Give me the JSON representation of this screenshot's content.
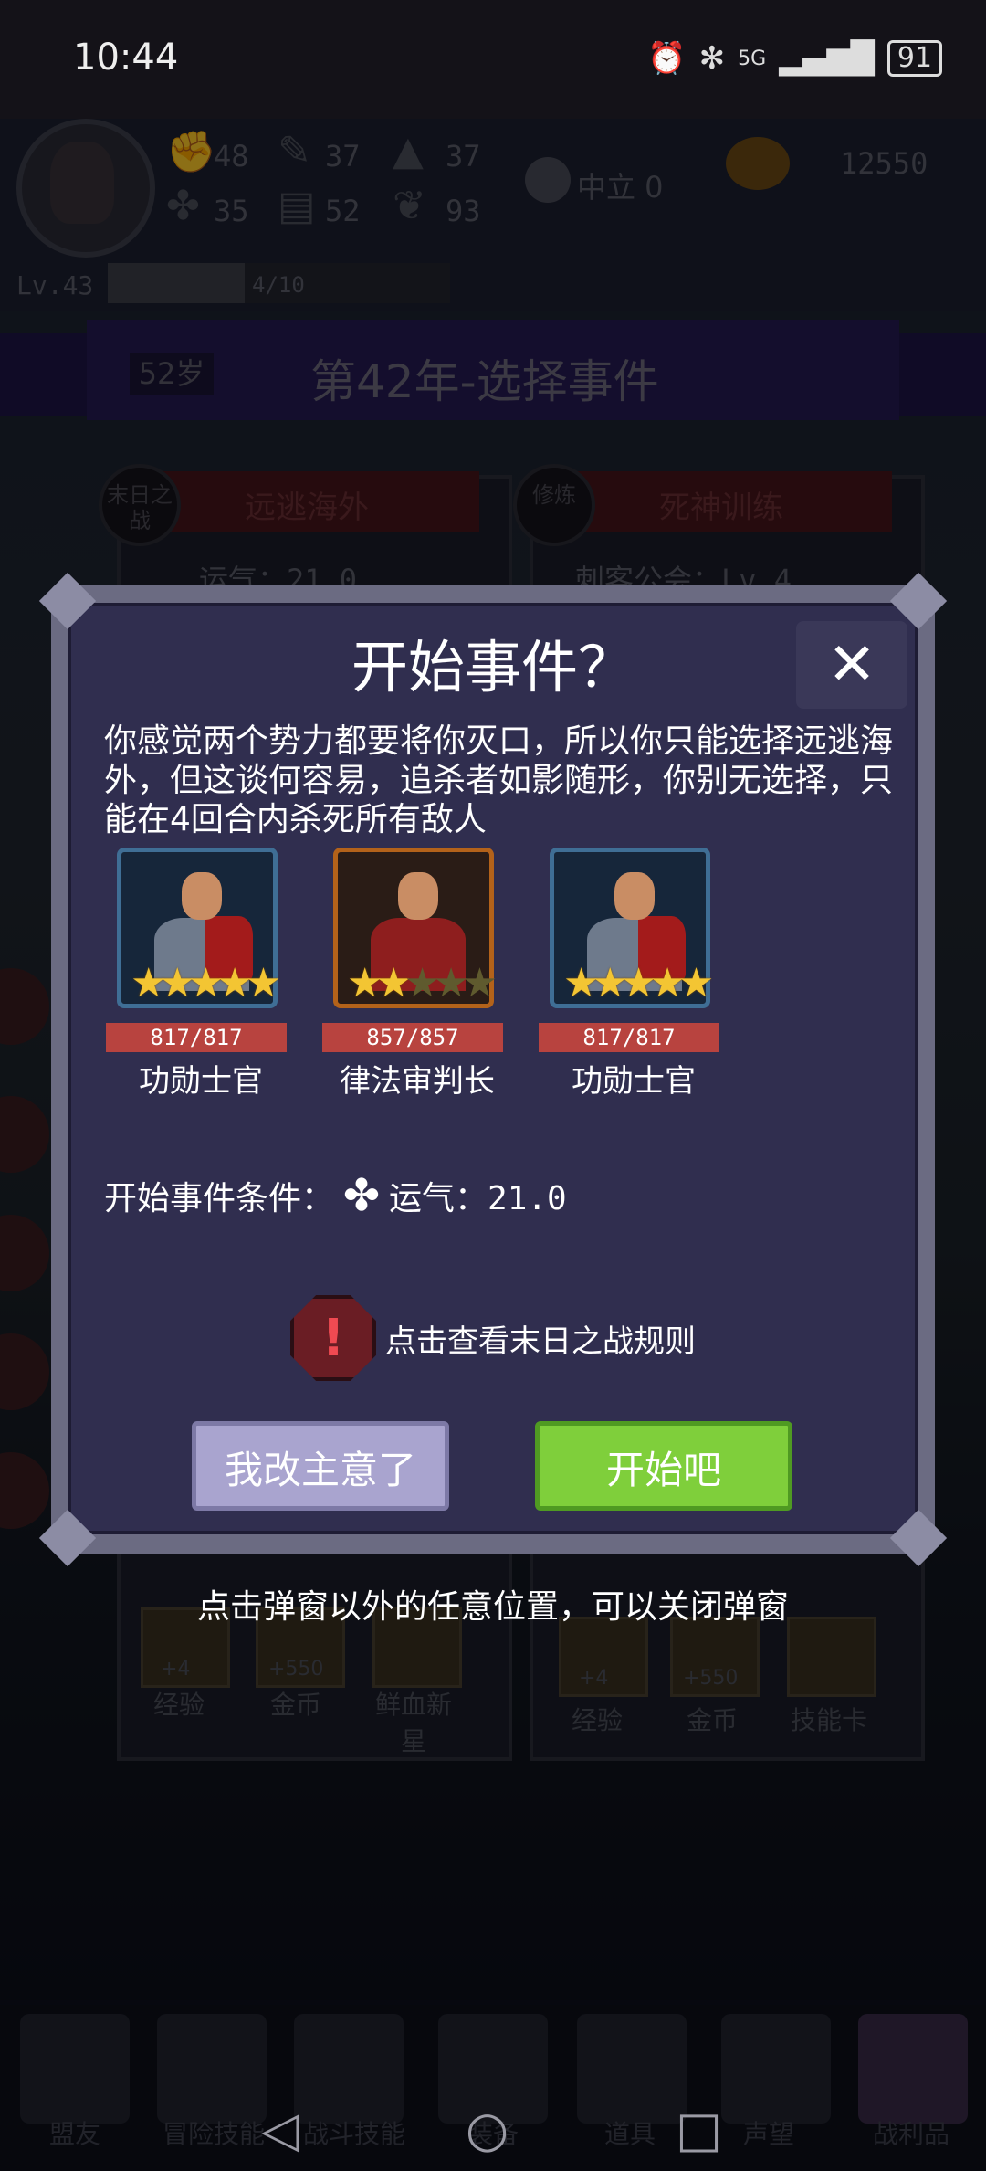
{
  "status_bar": {
    "time": "10:44",
    "signal": "5G",
    "battery": "91"
  },
  "header": {
    "stats": [
      "48",
      "37",
      "37",
      "35",
      "52",
      "93"
    ],
    "alignment": "中立 0",
    "coins": "12550",
    "level": "Lv.43",
    "exp": "4/10"
  },
  "banner": {
    "age": "52岁",
    "title": "第42年-选择事件"
  },
  "cards": [
    {
      "badge": "末日之战",
      "title": "远逃海外",
      "sub": "运气：21.0",
      "rewards": [
        "经验",
        "金币",
        "鲜血新星"
      ],
      "reward_values": [
        "+4",
        "+550"
      ]
    },
    {
      "badge": "修炼",
      "title": "死神训练",
      "sub": "刺客公会：Lv.4",
      "rewards": [
        "经验",
        "金币",
        "技能卡"
      ],
      "reward_values": [
        "+4",
        "+550"
      ]
    }
  ],
  "dialog": {
    "title": "开始事件？",
    "description": "你感觉两个势力都要将你灭口，所以你只能选择远逃海外，但这谈何容易，追杀者如影随形，你别无选择，只能在4回合内杀死所有敌人",
    "units": [
      {
        "name": "功勋士官",
        "hp": "817/817",
        "stars": 5,
        "frame": "blue"
      },
      {
        "name": "律法审判长",
        "hp": "857/857",
        "stars": 2,
        "frame": "gold"
      },
      {
        "name": "功勋士官",
        "hp": "817/817",
        "stars": 5,
        "frame": "blue"
      }
    ],
    "condition_label": "开始事件条件：",
    "condition_icon": "clover-icon",
    "condition_value": "运气：21.0",
    "rules_link": "点击查看末日之战规则",
    "cancel_label": "我改主意了",
    "start_label": "开始吧",
    "close_symbol": "✕"
  },
  "hint": "点击弹窗以外的任意位置，可以关闭弹窗",
  "bottom_nav": [
    "盟友",
    "冒险技能",
    "战斗技能",
    "装备",
    "道具",
    "声望",
    "战利品"
  ],
  "colors": {
    "dialog_bg": "#302e4f",
    "start_button": "#7fcf3b",
    "cancel_button": "#a9a4cf",
    "hp_bar": "#b8433f"
  }
}
